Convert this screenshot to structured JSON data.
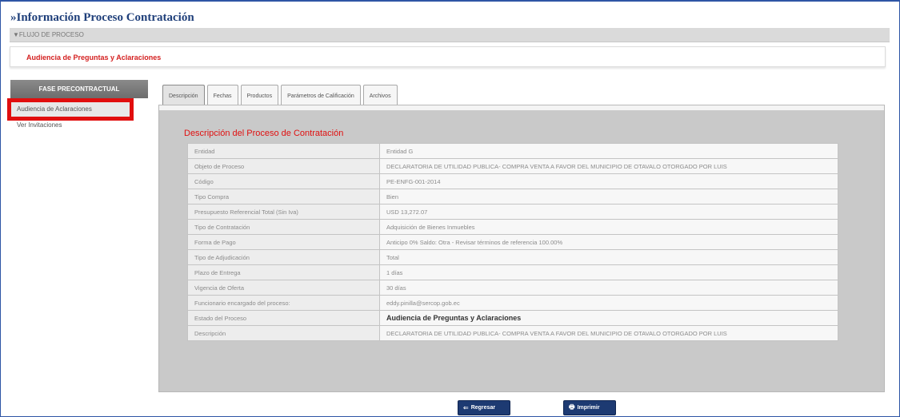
{
  "page_title": "»Información Proceso Contratación",
  "flow_bar": "▼FLUJO DE PROCESO",
  "stage_label": "Audiencia de Preguntas y Aclaraciones",
  "sidebar": {
    "header": "FASE PRECONTRACTUAL",
    "items": [
      {
        "label": "Audiencia de Aclaraciones"
      },
      {
        "label": "Ver Invitaciones"
      }
    ]
  },
  "tabs": [
    {
      "label": "Descripción"
    },
    {
      "label": "Fechas"
    },
    {
      "label": "Productos"
    },
    {
      "label": "Parámetros de Calificación"
    },
    {
      "label": "Archivos"
    }
  ],
  "section_title": "Descripción del Proceso de Contratación",
  "details": [
    {
      "label": "Entidad",
      "value": "Entidad G"
    },
    {
      "label": "Objeto de Proceso",
      "value": "DECLARATORIA DE UTILIDAD PUBLICA- COMPRA VENTA A FAVOR DEL MUNICIPIO DE OTAVALO OTORGADO POR LUIS"
    },
    {
      "label": "Código",
      "value": "PE-ENFG-001-2014"
    },
    {
      "label": "Tipo Compra",
      "value": "Bien"
    },
    {
      "label": "Presupuesto Referencial Total (Sin Iva)",
      "value": "USD 13,272.07"
    },
    {
      "label": "Tipo de Contratación",
      "value": "Adquisición de Bienes Inmuebles"
    },
    {
      "label": "Forma de Pago",
      "value": "Anticipo 0% Saldo: Otra - Revisar términos de referencia 100.00%"
    },
    {
      "label": "Tipo de Adjudicación",
      "value": "Total"
    },
    {
      "label": "Plazo de Entrega",
      "value": "1 días"
    },
    {
      "label": "Vigencia de Oferta",
      "value": "30 días"
    },
    {
      "label": "Funcionario encargado del proceso:",
      "value": "eddy.pinilla@sercop.gob.ec"
    },
    {
      "label": "Estado del Proceso",
      "value": "Audiencia de Preguntas y Aclaraciones"
    },
    {
      "label": "Descripción",
      "value": "DECLARATORIA DE UTILIDAD PUBLICA- COMPRA VENTA A FAVOR DEL MUNICIPIO DE OTAVALO OTORGADO POR LUIS"
    }
  ],
  "buttons": {
    "back": "Regresar",
    "print": "Imprimir"
  },
  "icons": {
    "back": "arrow-left-icon",
    "print": "printer-icon"
  },
  "colors": {
    "title": "#1f3f7a",
    "accent_red": "#d42020",
    "button_bg": "#1d3a72",
    "highlight_box": "#e10e0e"
  }
}
